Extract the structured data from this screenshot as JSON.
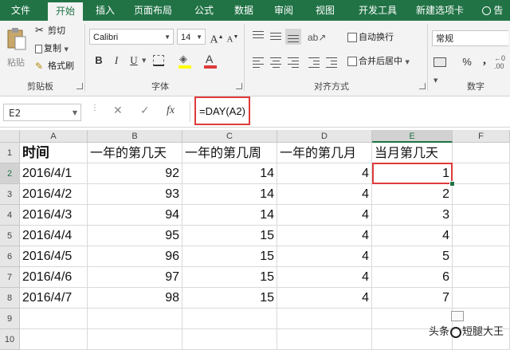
{
  "tabs": [
    "文件",
    "开始",
    "插入",
    "页面布局",
    "公式",
    "数据",
    "审阅",
    "视图",
    "开发工具",
    "新建选项卡",
    "告"
  ],
  "active_tab": "开始",
  "ribbon": {
    "clipboard": {
      "paste": "粘贴",
      "cut": "剪切",
      "copy": "复制",
      "painter": "格式刷",
      "label": "剪贴板"
    },
    "font": {
      "name": "Calibri",
      "size": "14",
      "bold": "B",
      "italic": "I",
      "underline": "U",
      "grow": "A",
      "shrink": "A",
      "label": "字体"
    },
    "alignment": {
      "wrap": "自动换行",
      "merge": "合并后居中",
      "label": "对齐方式"
    },
    "number": {
      "format": "常规",
      "percent": "%",
      "comma": ",",
      "label": "数字"
    }
  },
  "formula_bar": {
    "name_box": "E2",
    "cancel": "✕",
    "enter": "✓",
    "fx": "fx",
    "formula": "=DAY(A2)"
  },
  "grid": {
    "columns": [
      "A",
      "B",
      "C",
      "D",
      "E",
      "F"
    ],
    "rows": [
      "1",
      "2",
      "3",
      "4",
      "5",
      "6",
      "7",
      "8",
      "9",
      "10"
    ],
    "headers": [
      "时间",
      "一年的第几天",
      "一年的第几周",
      "一年的第几月",
      "当月第几天"
    ],
    "data": [
      [
        "2016/4/1",
        "92",
        "14",
        "4",
        "1"
      ],
      [
        "2016/4/2",
        "93",
        "14",
        "4",
        "2"
      ],
      [
        "2016/4/3",
        "94",
        "14",
        "4",
        "3"
      ],
      [
        "2016/4/4",
        "95",
        "15",
        "4",
        "4"
      ],
      [
        "2016/4/5",
        "96",
        "15",
        "4",
        "5"
      ],
      [
        "2016/4/6",
        "97",
        "15",
        "4",
        "6"
      ],
      [
        "2016/4/7",
        "98",
        "15",
        "4",
        "7"
      ]
    ],
    "active_cell": "E2"
  },
  "watermark": {
    "prefix": "头条",
    "suffix": "短腿大王"
  },
  "colors": {
    "accent": "#217346",
    "highlight": "#e03a3a"
  }
}
